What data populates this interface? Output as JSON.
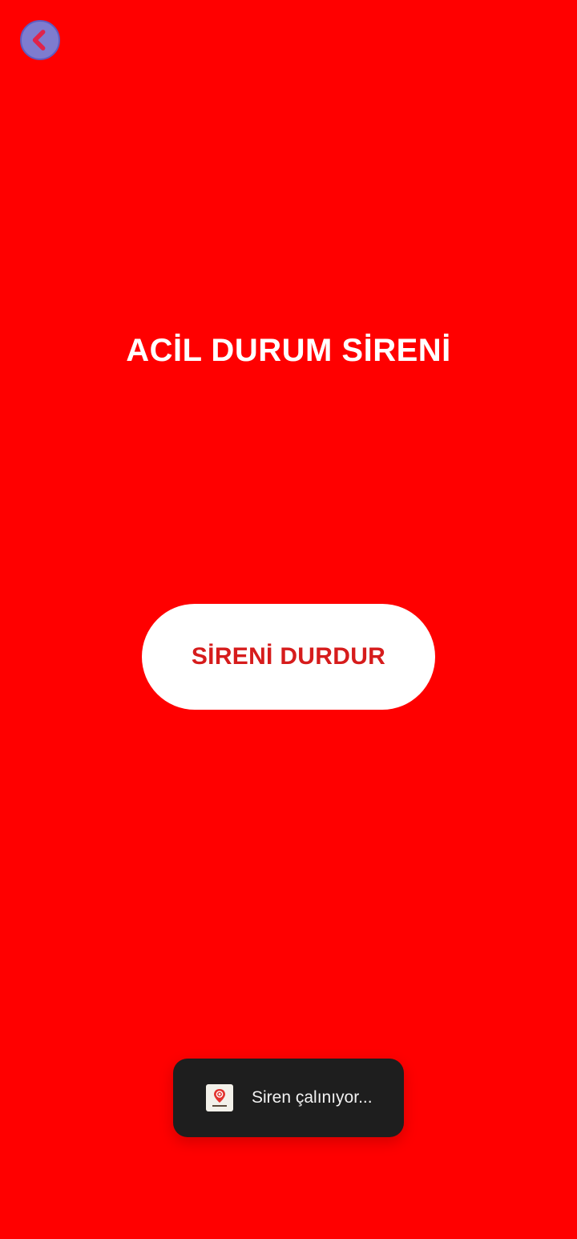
{
  "header": {
    "back_icon": "chevron-left-icon"
  },
  "main": {
    "title": "ACİL DURUM SİRENİ",
    "stop_button_label": "SİRENİ DURDUR"
  },
  "toast": {
    "app_icon": "app-logo-icon",
    "message": "Siren çalınıyor..."
  },
  "colors": {
    "background": "#ff0000",
    "button_bg": "#ffffff",
    "button_text": "#d61c1c",
    "back_button_bg": "#7e7ccf",
    "back_chevron": "#e0234a",
    "toast_bg": "#1e1e1e",
    "toast_text": "#f2f2f2"
  }
}
